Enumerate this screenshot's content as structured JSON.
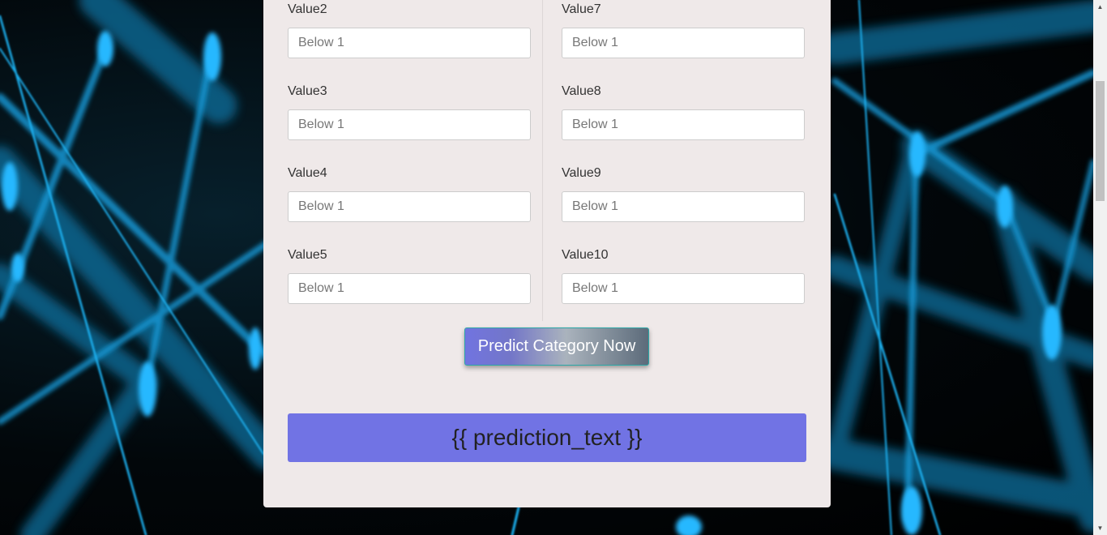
{
  "form": {
    "left_fields": [
      {
        "label": "Value2",
        "placeholder": "Below 1"
      },
      {
        "label": "Value3",
        "placeholder": "Below 1"
      },
      {
        "label": "Value4",
        "placeholder": "Below 1"
      },
      {
        "label": "Value5",
        "placeholder": "Below 1"
      }
    ],
    "right_fields": [
      {
        "label": "Value7",
        "placeholder": "Below 1"
      },
      {
        "label": "Value8",
        "placeholder": "Below 1"
      },
      {
        "label": "Value9",
        "placeholder": "Below 1"
      },
      {
        "label": "Value10",
        "placeholder": "Below 1"
      }
    ],
    "submit_label": "Predict Category Now"
  },
  "result": {
    "prediction_text": "{{ prediction_text }}"
  },
  "colors": {
    "card_background": "#efe9e9",
    "prediction_background": "#7173e4",
    "button_gradient_start": "#7174e0",
    "button_gradient_end": "#5c6b7a",
    "background_network": "#1aa6e6"
  },
  "scrollbar": {
    "up_icon": "triangle-up-icon",
    "down_icon": "triangle-down-icon"
  }
}
